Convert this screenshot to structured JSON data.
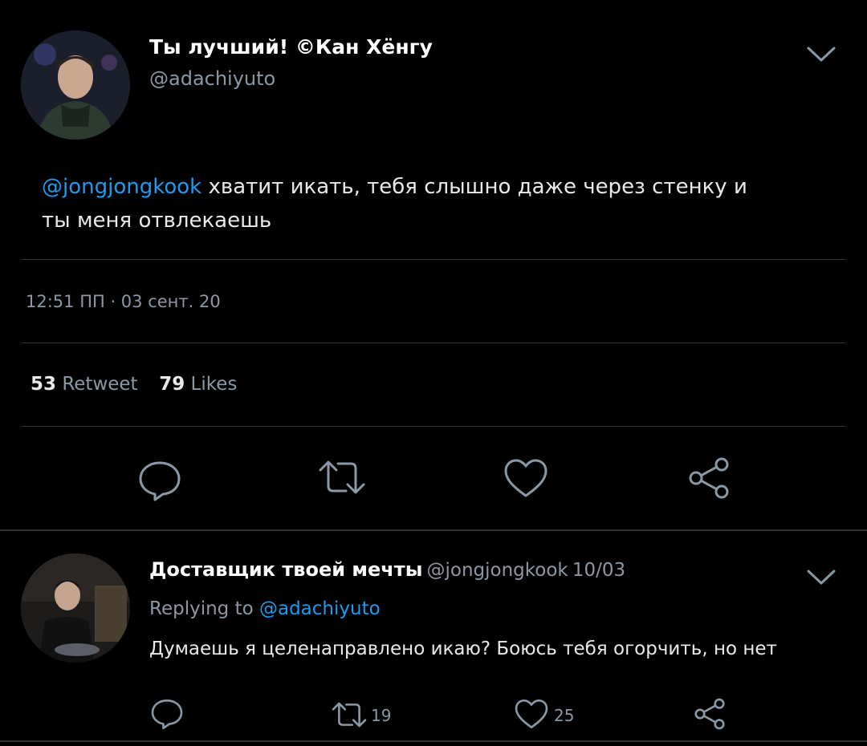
{
  "tweet": {
    "author_name": "Ты лучший! ©Кан Хёнгу",
    "author_handle": "@adachiyuto",
    "mention": "@jongjongkook",
    "text": " хватит икать, тебя слышно даже через стенку и ты меня отвлекаешь",
    "timestamp": "12:51 ПП · 03 сент. 20",
    "retweets_count": "53",
    "retweets_label": "Retweet",
    "likes_count": "79",
    "likes_label": "Likes"
  },
  "reply": {
    "author_name": "Доставщик твоей мечты",
    "author_handle": "@jongjongkook",
    "date": "10/03",
    "replying_to_label": "Replying to",
    "replying_to_handle": "@adachiyuto",
    "text": "Думаешь я целенаправлено икаю? Боюсь тебя огорчить, но нет",
    "retweets_count": "19",
    "likes_count": "25"
  },
  "colors": {
    "background": "#000000",
    "accent": "#1d9bf0",
    "secondary_text": "#8b98a5",
    "divider": "#2f3336"
  },
  "icons": [
    "chevron-down-icon",
    "reply-icon",
    "retweet-icon",
    "like-icon",
    "share-icon"
  ]
}
